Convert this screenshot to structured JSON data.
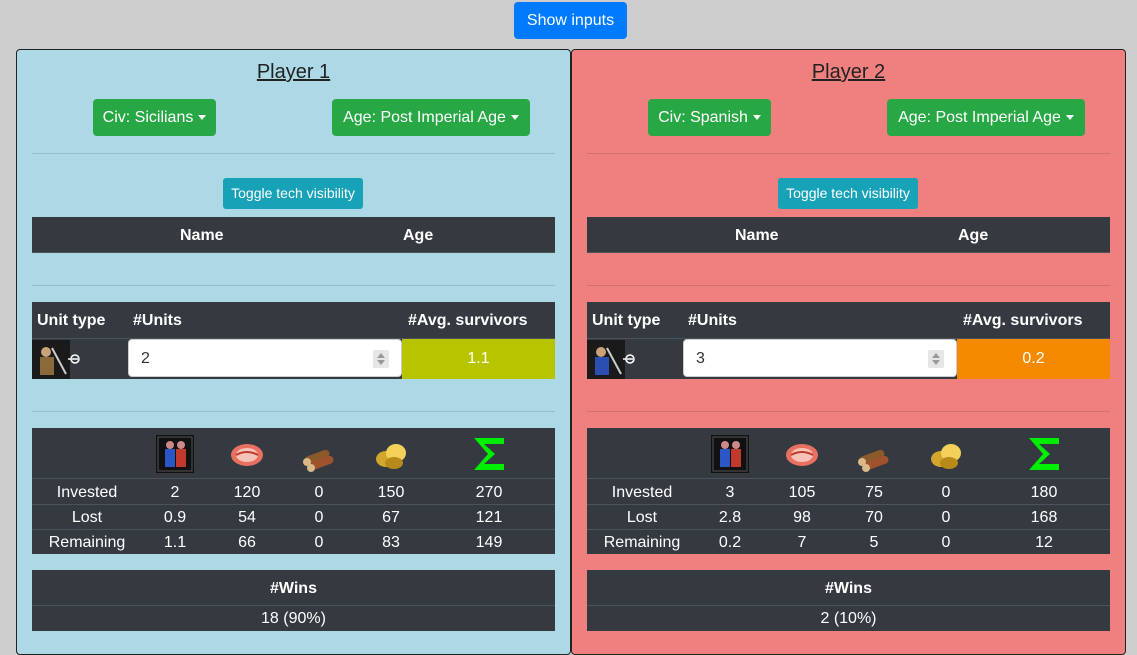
{
  "top_button": "Show inputs",
  "players": [
    {
      "title": "Player 1",
      "bg": "#add8e6",
      "civ": "Civ: Sicilians",
      "age": "Age: Post Imperial Age",
      "toggle": "Toggle tech visibility",
      "tech_headers": {
        "name": "Name",
        "age": "Age"
      },
      "unit_headers": {
        "type": "Unit type",
        "units": "#Units",
        "survivors": "#Avg. survivors"
      },
      "unit_count": "2",
      "survivors": "1.1",
      "survivors_color": "#b8c400",
      "resource_icons": [
        "unit-icon",
        "food-icon",
        "wood-icon",
        "gold-icon",
        "sum-icon"
      ],
      "rows": [
        {
          "label": "Invested",
          "values": [
            "2",
            "120",
            "0",
            "150",
            "270"
          ]
        },
        {
          "label": "Lost",
          "values": [
            "0.9",
            "54",
            "0",
            "67",
            "121"
          ]
        },
        {
          "label": "Remaining",
          "values": [
            "1.1",
            "66",
            "0",
            "83",
            "149"
          ]
        }
      ],
      "wins_header": "#Wins",
      "wins": "18 (90%)"
    },
    {
      "title": "Player 2",
      "bg": "#f08080",
      "civ": "Civ: Spanish",
      "age": "Age: Post Imperial Age",
      "toggle": "Toggle tech visibility",
      "tech_headers": {
        "name": "Name",
        "age": "Age"
      },
      "unit_headers": {
        "type": "Unit type",
        "units": "#Units",
        "survivors": "#Avg. survivors"
      },
      "unit_count": "3",
      "survivors": "0.2",
      "survivors_color": "#f58a00",
      "resource_icons": [
        "unit-icon",
        "food-icon",
        "wood-icon",
        "gold-icon",
        "sum-icon"
      ],
      "rows": [
        {
          "label": "Invested",
          "values": [
            "3",
            "105",
            "75",
            "0",
            "180"
          ]
        },
        {
          "label": "Lost",
          "values": [
            "2.8",
            "98",
            "70",
            "0",
            "168"
          ]
        },
        {
          "label": "Remaining",
          "values": [
            "0.2",
            "7",
            "5",
            "0",
            "12"
          ]
        }
      ],
      "wins_header": "#Wins",
      "wins": "2 (10%)"
    }
  ]
}
